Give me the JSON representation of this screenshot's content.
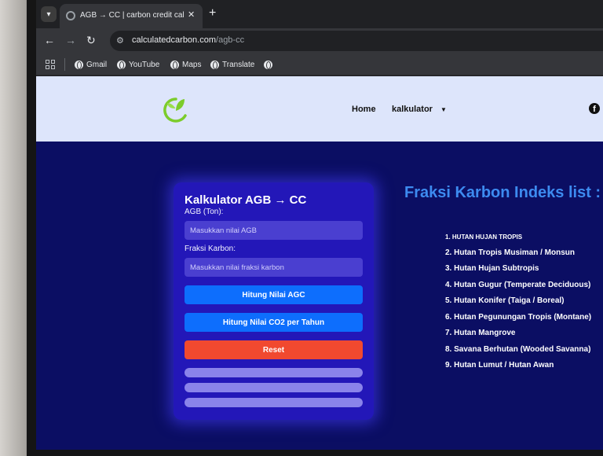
{
  "browser": {
    "tab_title": "AGB → CC | carbon credit calcu",
    "url_domain": "calculatedcarbon.com",
    "url_path": "/agb-cc",
    "bookmarks": [
      "Gmail",
      "YouTube",
      "Maps",
      "Translate",
      ""
    ]
  },
  "site": {
    "brand_color": "#7ccc2b",
    "nav": {
      "home": "Home",
      "kalkulator": "kalkulator"
    }
  },
  "calculator": {
    "title": "Kalkulator AGB → CC",
    "agb_label": "AGB (Ton):",
    "agb_placeholder": "Masukkan nilai AGB",
    "fraksi_label": "Fraksi Karbon:",
    "fraksi_placeholder": "Masukkan nilai fraksi karbon",
    "btn_agc": "Hitung Nilai AGC",
    "btn_co2": "Hitung Nilai CO2 per Tahun",
    "btn_reset": "Reset"
  },
  "fraksi_list": {
    "title": "Fraksi Karbon Indeks list :",
    "items": [
      "1. HUTAN HUJAN TROPIS",
      "2. Hutan Tropis Musiman / Monsun",
      "3. Hutan Hujan Subtropis",
      "4. Hutan Gugur (Temperate Deciduous)",
      "5. Hutan Konifer (Taiga / Boreal)",
      "6. Hutan Pegunungan Tropis (Montane)",
      "7. Hutan Mangrove",
      "8. Savana Berhutan (Wooded Savanna)",
      "9. Hutan Lumut / Hutan Awan"
    ]
  },
  "colors": {
    "page_bg": "#0b0e63",
    "header_bg": "#dde5fb",
    "card_bg": "#2317b8",
    "button_blue": "#0d6efd",
    "button_red": "#f1492f",
    "list_title": "#3d8bf0"
  }
}
